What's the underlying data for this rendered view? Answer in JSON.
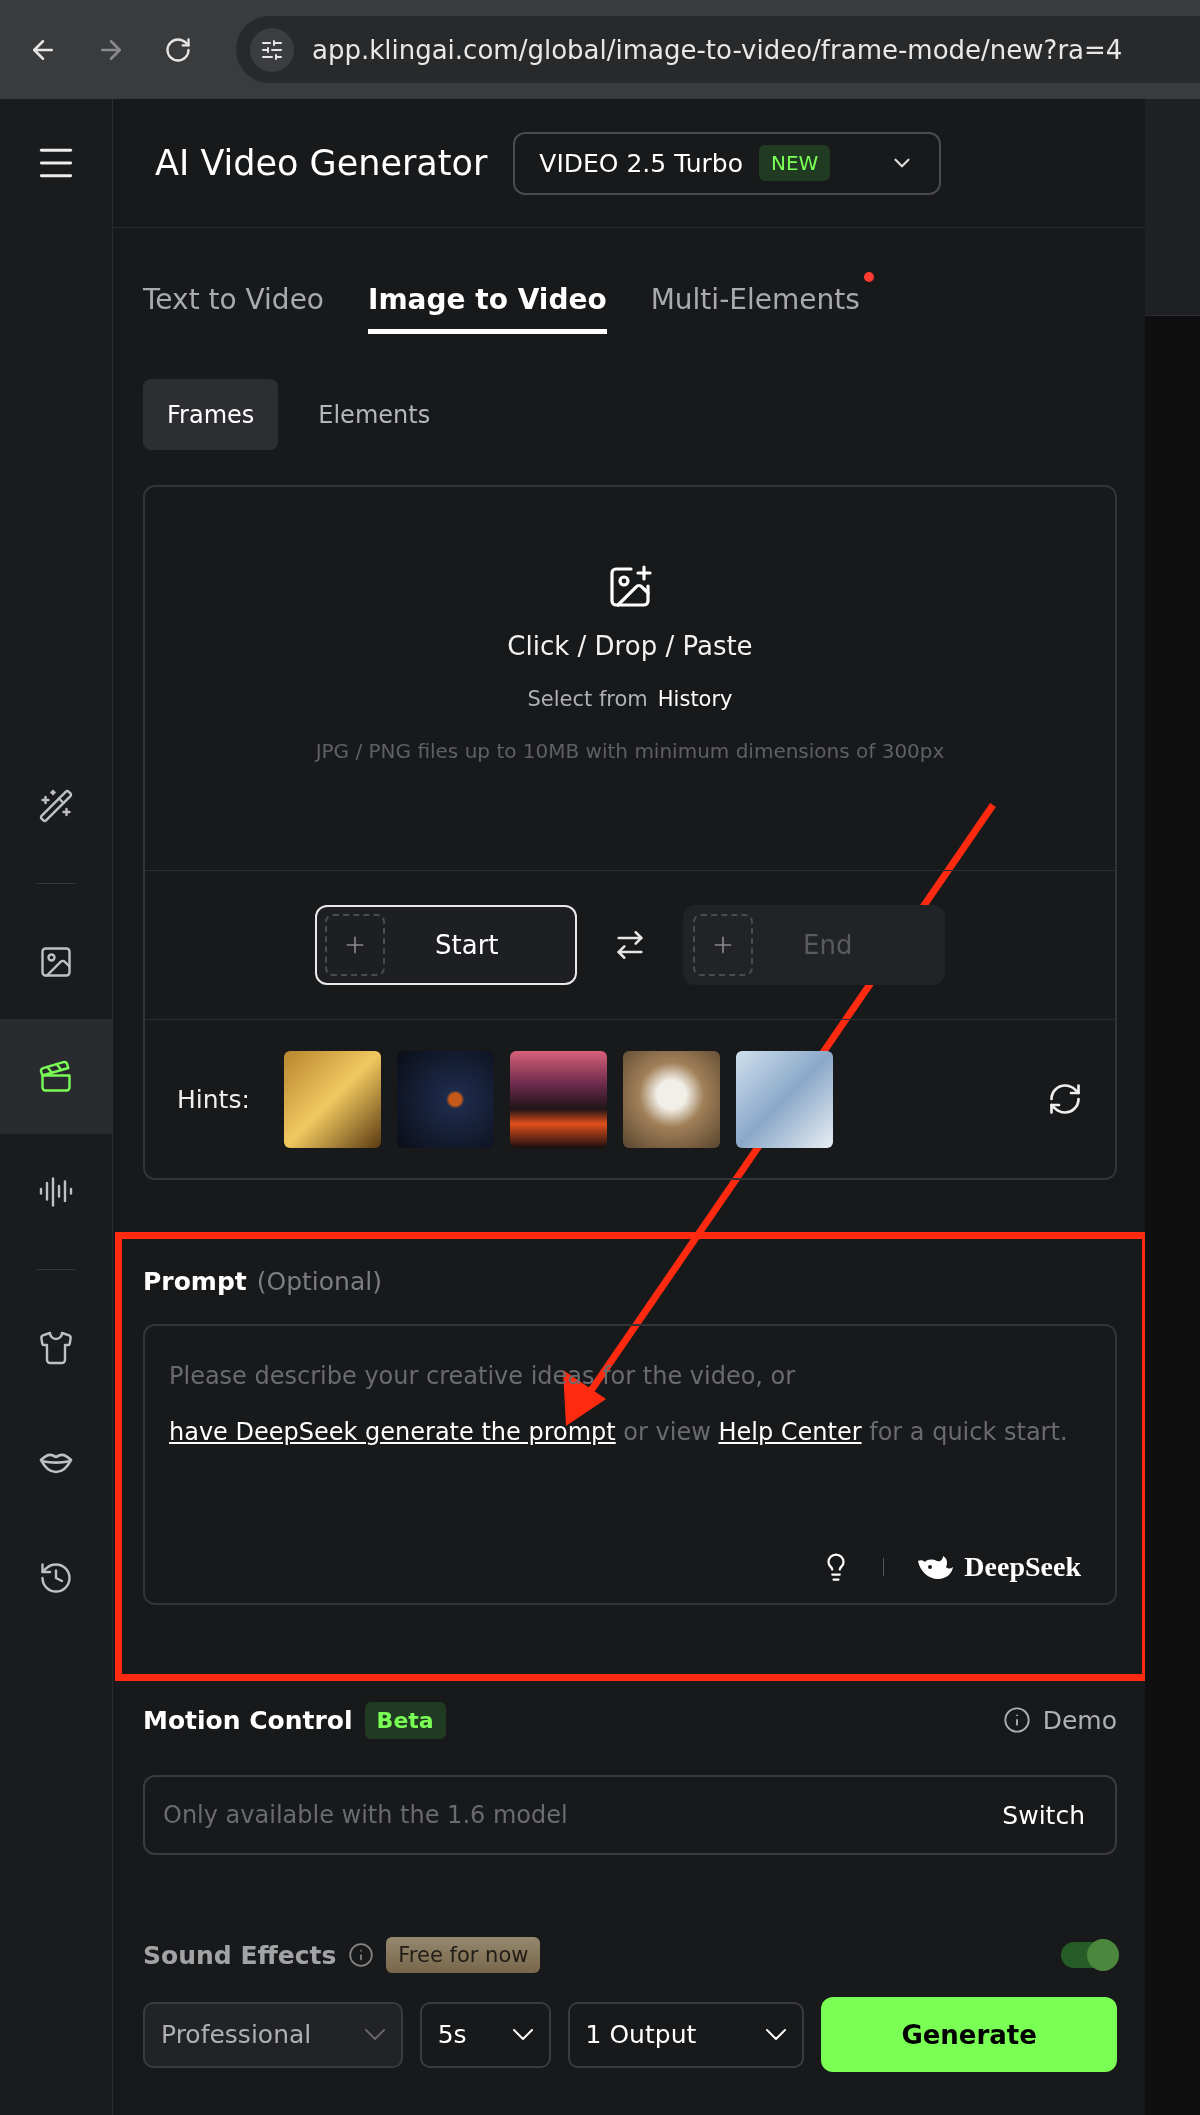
{
  "browser": {
    "url": "app.klingai.com/global/image-to-video/frame-mode/new?ra=4"
  },
  "sidebar": {
    "groups": [
      [
        {
          "selected": false
        }
      ],
      [
        {
          "selected": false
        },
        {
          "selected": true
        },
        {
          "selected": false
        }
      ],
      [
        {
          "selected": false
        },
        {
          "selected": false
        },
        {
          "selected": false
        }
      ]
    ]
  },
  "header": {
    "title": "AI Video Generator",
    "model": {
      "label": "VIDEO 2.5 Turbo",
      "badge": "NEW"
    }
  },
  "tabs": [
    {
      "label": "Text to Video",
      "selected": false,
      "notification": false
    },
    {
      "label": "Image to Video",
      "selected": true,
      "notification": false
    },
    {
      "label": "Multi-Elements",
      "selected": false,
      "notification": true
    }
  ],
  "subtabs": [
    {
      "label": "Frames",
      "selected": true
    },
    {
      "label": "Elements",
      "selected": false
    }
  ],
  "upload": {
    "title": "Click / Drop / Paste",
    "history_prefix": "Select from",
    "history_link": "History",
    "note": "JPG / PNG files up to 10MB with minimum dimensions of 300px"
  },
  "frames": [
    {
      "label": "Start",
      "disabled": false
    },
    {
      "label": "End",
      "disabled": true
    }
  ],
  "hints": {
    "label": "Hints:",
    "thumbnails": [
      {
        "kind": "photo"
      },
      {
        "kind": "photo"
      },
      {
        "kind": "photo"
      },
      {
        "kind": "photo"
      },
      {
        "kind": "photo"
      }
    ]
  },
  "prompt": {
    "label": "Prompt",
    "optional": "(Optional)",
    "placeholder": [
      {
        "kind": "text",
        "text": "Please describe your creative ideas for the video, or "
      },
      {
        "kind": "link",
        "text": "have DeepSeek generate the prompt"
      },
      {
        "kind": "text",
        "text": " or view "
      },
      {
        "kind": "link",
        "text": "Help Center"
      },
      {
        "kind": "text",
        "text": " for a quick start."
      }
    ],
    "brand": "DeepSeek"
  },
  "motion": {
    "label": "Motion Control",
    "badge": "Beta",
    "demo": "Demo",
    "placeholder": "Only available with the 1.6 model",
    "action": "Switch"
  },
  "sound": {
    "label": "Sound Effects",
    "badge": "Free for now",
    "on": true
  },
  "footer": {
    "mode": "Professional",
    "duration": "5s",
    "outputs": "1 Output",
    "generate": "Generate"
  }
}
